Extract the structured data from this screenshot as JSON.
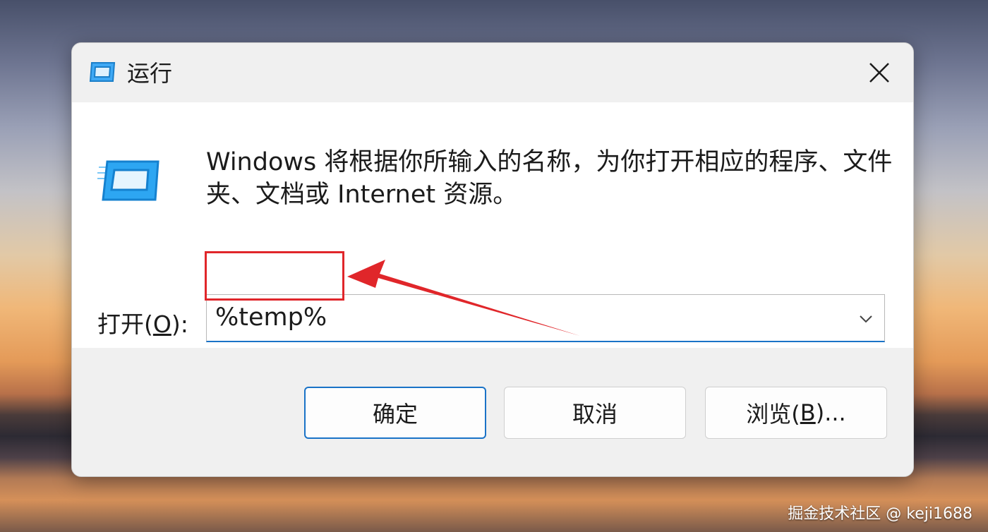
{
  "window": {
    "title": "运行",
    "icon": "run-icon"
  },
  "content": {
    "description": "Windows 将根据你所输入的名称，为你打开相应的程序、文件夹、文档或 Internet 资源。",
    "open_label_prefix": "打开(",
    "open_label_accel": "O",
    "open_label_suffix": "):",
    "open_value": "%temp%"
  },
  "buttons": {
    "ok": "确定",
    "cancel": "取消",
    "browse_prefix": "浏览(",
    "browse_accel": "B",
    "browse_suffix": ")..."
  },
  "annotation": {
    "color": "#e0262a"
  },
  "watermark": "掘金技术社区 @ keji1688"
}
